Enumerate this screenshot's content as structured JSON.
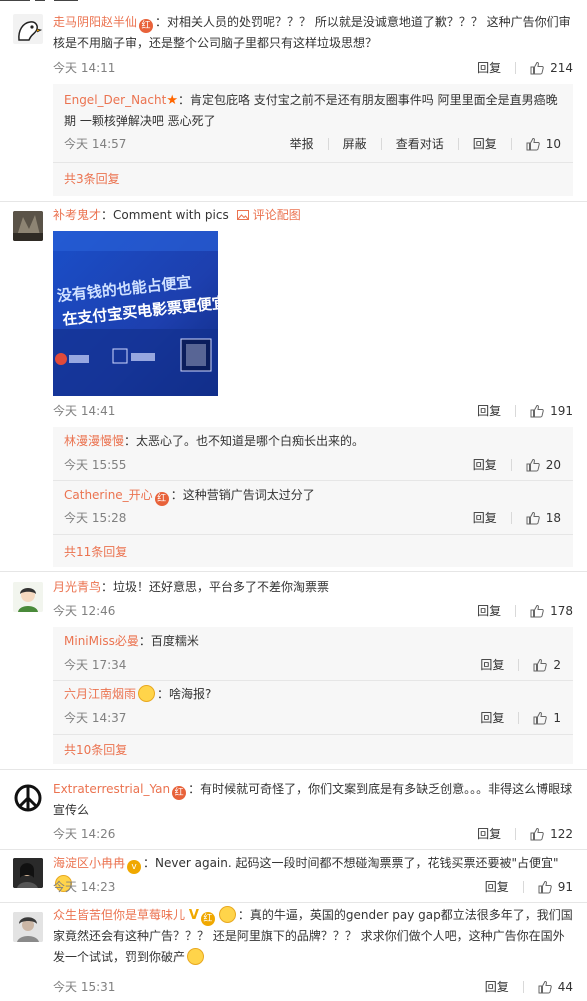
{
  "actions": {
    "reply": "回复",
    "report": "举报",
    "block": "屏蔽",
    "view_conversation": "查看对话"
  },
  "comments": [
    {
      "user": "走马阴阳赵半仙",
      "text": "：对相关人员的处罚呢？？？ 所以就是没诚意地道了歉？？？ 这种广告你们审核是不用脑子审，还是整个公司脑子里都只有这样垃圾思想？",
      "time": "今天 14:11",
      "likes": "214",
      "replies": [
        {
          "user": "Engel_Der_Nacht",
          "text": "：肯定包庇咯 支付宝之前不是还有朋友圈事件吗 阿里里面全是直男癌晚期 一颗核弹解决吧 恶心死了",
          "time": "今天 14:57",
          "likes": "10"
        }
      ],
      "more": "共3条回复"
    },
    {
      "user": "补考鬼才",
      "text": "：Comment with pics",
      "pic_link": "评论配图",
      "time": "今天 14:41",
      "likes": "191",
      "photo_lines": [
        "没有钱的也能占便宜",
        "在支付宝买电影票更便宜"
      ],
      "replies": [
        {
          "user": "林漫漫慢慢",
          "text": "：太恶心了。也不知道是哪个白痴长出来的。",
          "time": "今天 15:55",
          "likes": "20"
        },
        {
          "user": "Catherine_开心",
          "text": "：这种营销广告词太过分了",
          "time": "今天 15:28",
          "likes": "18"
        }
      ],
      "more": "共11条回复"
    },
    {
      "user": "月光青鸟",
      "text": "：垃圾！还好意思，平台多了不差你淘票票",
      "time": "今天 12:46",
      "likes": "178",
      "replies": [
        {
          "user": "MiniMiss必曼",
          "text": "：百度糯米",
          "time": "今天 17:34",
          "likes": "2"
        },
        {
          "user": "六月江南烟雨",
          "text": "：啥海报?",
          "time": "今天 14:37",
          "likes": "1"
        }
      ],
      "more": "共10条回复"
    },
    {
      "user": "Extraterrestrial_Yan",
      "text": "：有时候就可奇怪了，你们文案到底是有多缺乏创意。。。非得这么博眼球宣传么",
      "time": "今天 14:26",
      "likes": "122"
    },
    {
      "user": "海淀区小冉冉",
      "text": "：Never again. 起码这一段时间都不想碰淘票票了，花钱买票还要被\"占便宜\"",
      "time": "今天 14:23",
      "likes": "91"
    },
    {
      "user": "众生皆苦但你是草莓味儿",
      "text": "：真的牛逼，英国的gender pay gap都立法很多年了，我们国家竟然还会有这种广告？？？ 还是阿里旗下的品牌？？？ 求求你们做个人吧，这种广告你在国外发一个试试，罚到你破产",
      "time": "今天 15:31",
      "likes": "44"
    }
  ]
}
